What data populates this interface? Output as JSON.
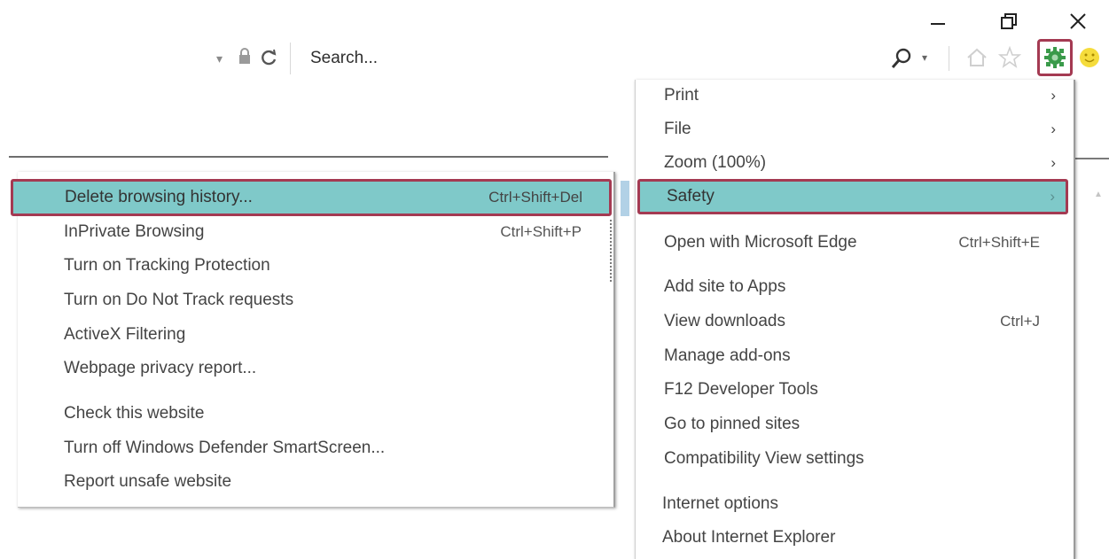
{
  "window": {
    "minimize_glyph": "—",
    "maximize_glyph": "🗗",
    "close_glyph": "✕"
  },
  "toolbar": {
    "address_dropdown_glyph": "▾",
    "search_placeholder": "Search...",
    "search_dropdown_glyph": "▾",
    "icons": [
      "lock-icon",
      "refresh-icon",
      "search-icon",
      "home-icon",
      "favorites-star-icon",
      "gear-icon",
      "smiley-feedback-icon"
    ]
  },
  "tools_menu": {
    "items": [
      {
        "label": "Print",
        "shortcut": "",
        "arrow": "›"
      },
      {
        "label": "File",
        "shortcut": "",
        "arrow": "›"
      },
      {
        "label": "Zoom (100%)",
        "shortcut": "",
        "arrow": "›"
      },
      {
        "label": "Safety",
        "shortcut": "",
        "arrow": "›"
      },
      {
        "label": "Open with Microsoft Edge",
        "shortcut": "Ctrl+Shift+E",
        "arrow": ""
      },
      {
        "label": "Add site to Apps",
        "shortcut": "",
        "arrow": ""
      },
      {
        "label": "View downloads",
        "shortcut": "Ctrl+J",
        "arrow": ""
      },
      {
        "label": "Manage add-ons",
        "shortcut": "",
        "arrow": ""
      },
      {
        "label": "F12 Developer Tools",
        "shortcut": "",
        "arrow": ""
      },
      {
        "label": "Go to pinned sites",
        "shortcut": "",
        "arrow": ""
      },
      {
        "label": "Compatibility View settings",
        "shortcut": "",
        "arrow": ""
      },
      {
        "label": "Internet options",
        "shortcut": "",
        "arrow": ""
      },
      {
        "label": "About Internet Explorer",
        "shortcut": "",
        "arrow": ""
      }
    ]
  },
  "safety_submenu": {
    "items": [
      {
        "label": "Delete browsing history...",
        "shortcut": "Ctrl+Shift+Del"
      },
      {
        "label": "InPrivate Browsing",
        "shortcut": "Ctrl+Shift+P"
      },
      {
        "label": "Turn on Tracking Protection",
        "shortcut": ""
      },
      {
        "label": "Turn on Do Not Track requests",
        "shortcut": ""
      },
      {
        "label": "ActiveX Filtering",
        "shortcut": ""
      },
      {
        "label": "Webpage privacy report...",
        "shortcut": ""
      },
      {
        "label": "Check this website",
        "shortcut": ""
      },
      {
        "label": "Turn off Windows Defender SmartScreen...",
        "shortcut": ""
      },
      {
        "label": "Report unsafe website",
        "shortcut": ""
      }
    ]
  },
  "colors": {
    "highlight_fill": "#7fc9c9",
    "highlight_border": "#a43a52",
    "gear_green": "#3a9a4a"
  }
}
